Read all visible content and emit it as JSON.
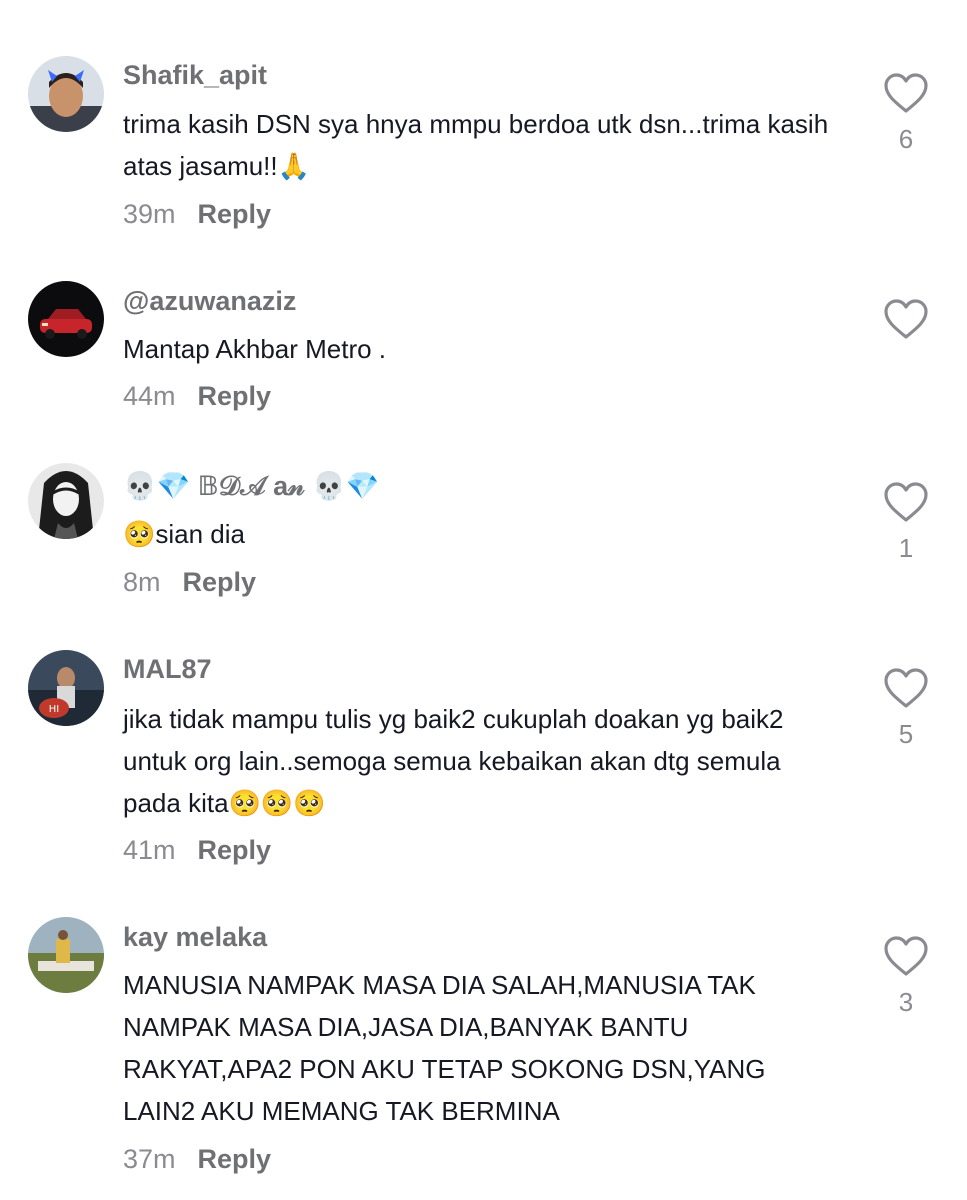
{
  "reply_label": "Reply",
  "comments": [
    {
      "username": "Shafik_apit",
      "text": "trima kasih DSN sya hnya mmpu berdoa utk dsn...trima kasih atas jasamu!!🙏",
      "time": "39m",
      "likes": "6"
    },
    {
      "username": "@azuwanaziz",
      "text": "Mantap Akhbar Metro .",
      "time": "44m",
      "likes": ""
    },
    {
      "username": "💀💎 𝔹𝒟𝒜 a𝓃 💀💎",
      "text": "🥺sian dia",
      "time": "8m",
      "likes": "1"
    },
    {
      "username": "MAL87",
      "text": "jika tidak mampu tulis yg baik2 cukuplah doakan yg baik2 untuk org lain..semoga semua kebaikan akan dtg semula pada kita🥺🥺🥺",
      "time": "41m",
      "likes": "5"
    },
    {
      "username": "kay melaka",
      "text": "MANUSIA NAMPAK MASA DIA SALAH,MANUSIA TAK NAMPAK MASA DIA,JASA DIA,BANYAK BANTU RAKYAT,APA2 PON AKU TETAP SOKONG DSN,YANG LAIN2 AKU MEMANG TAK BERMINA",
      "time": "37m",
      "likes": "3"
    }
  ]
}
